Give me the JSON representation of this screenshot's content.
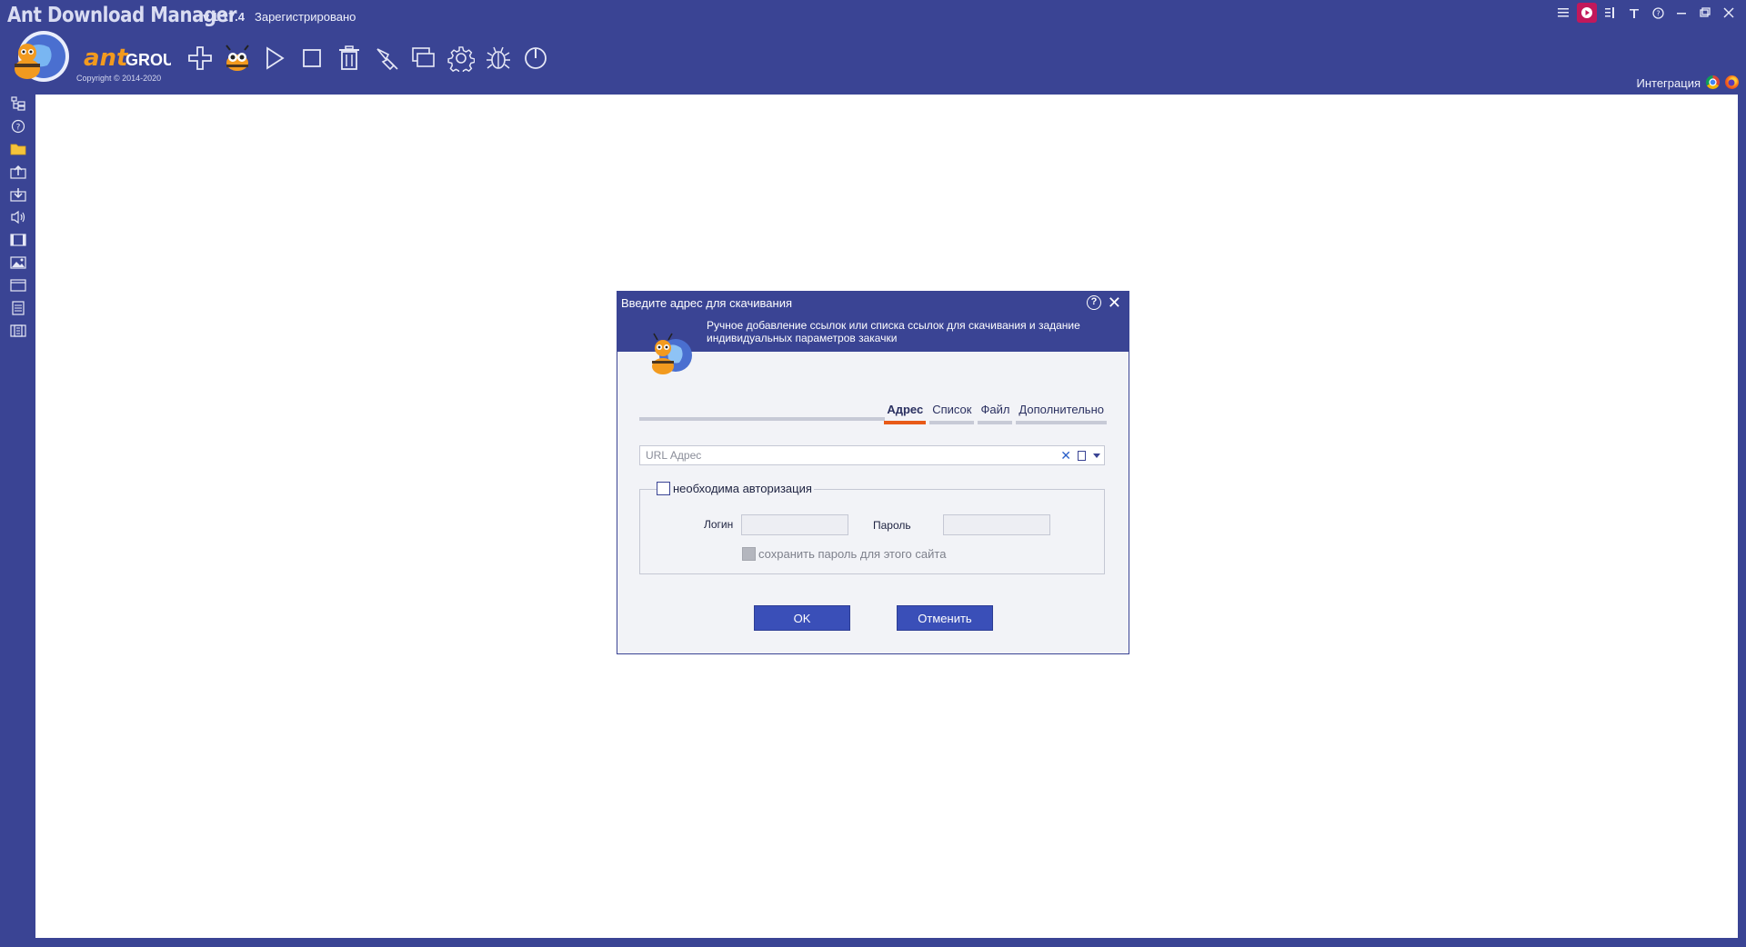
{
  "window": {
    "title": "Ant Download Manager",
    "version": "v.1.17.4",
    "status": "Зарегистрировано",
    "controls": [
      "menu-icon",
      "record-icon",
      "stats-icon",
      "pin-icon",
      "help-icon",
      "minimize-icon",
      "restore-icon",
      "close-icon"
    ]
  },
  "logo": {
    "brand_text": "ant GROUP",
    "copyright": "Copyright © 2014-2020"
  },
  "toolbar": {
    "items": [
      "add-icon",
      "ant-icon",
      "play-icon",
      "stop-icon",
      "delete-icon",
      "link-tool-icon",
      "windows-icon",
      "settings-icon",
      "bug-icon",
      "power-icon"
    ]
  },
  "integration": {
    "label": "Интеграция",
    "browsers": [
      "chrome-icon",
      "firefox-icon"
    ]
  },
  "sidebar": {
    "items": [
      "tree-icon",
      "help-circle-icon",
      "folder-icon",
      "upload-icon",
      "download-icon",
      "audio-icon",
      "video-icon",
      "image-icon",
      "window-icon",
      "document-icon",
      "archive-icon"
    ]
  },
  "dialog": {
    "title": "Введите адрес для скачивания",
    "description": "Ручное добавление ссылок или списка ссылок для скачивания и задание индивидуальных параметров закачки",
    "tabs": [
      "Адрес",
      "Список",
      "Файл",
      "Дополнительно"
    ],
    "active_tab": "Адрес",
    "url_placeholder": "URL Адрес",
    "auth_label": "необходима авторизация",
    "auth_checked": false,
    "login_label": "Логин",
    "password_label": "Пароль",
    "login_value": "",
    "password_value": "",
    "save_password_label": "сохранить пароль для этого сайта",
    "ok_label": "OK",
    "cancel_label": "Отменить"
  },
  "colors": {
    "chrome": "#3a4494",
    "content": "#ffffff",
    "dialog_bg": "#f2f3f7",
    "button": "#3a4fb8",
    "tab_active": "#e85a18",
    "record": "#c2185b"
  }
}
